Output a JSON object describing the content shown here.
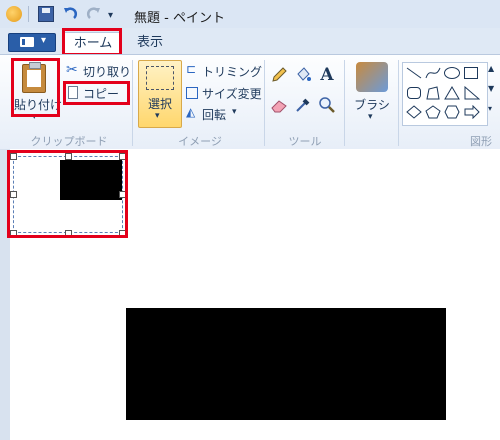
{
  "window": {
    "title": "無題 - ペイント"
  },
  "tabs": {
    "home": "ホーム",
    "view": "表示"
  },
  "clipboard": {
    "paste": "貼り付け",
    "cut": "切り取り",
    "copy": "コピー",
    "group": "クリップボード"
  },
  "image": {
    "select": "選択",
    "crop": "トリミング",
    "resize": "サイズ変更",
    "rotate": "回転",
    "group": "イメージ"
  },
  "tools": {
    "group": "ツール"
  },
  "brush": {
    "label": "ブラシ"
  },
  "shapes": {
    "group": "図形"
  }
}
